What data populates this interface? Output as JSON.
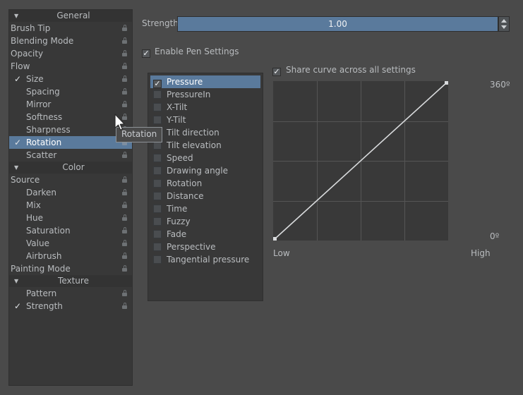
{
  "app": {
    "background_color": "#4a4a4a",
    "panel_color": "#383838",
    "accent_color": "#5a7a9c"
  },
  "sidebar": {
    "groups": [
      {
        "name": "General",
        "collapse_icon": "triangle-down-icon",
        "items": [
          {
            "label": "Brush Tip",
            "checkbox": false,
            "checked": false,
            "selected": false,
            "lock": true
          },
          {
            "label": "Blending Mode",
            "checkbox": false,
            "checked": false,
            "selected": false,
            "lock": true
          },
          {
            "label": "Opacity",
            "checkbox": false,
            "checked": false,
            "selected": false,
            "lock": true
          },
          {
            "label": "Flow",
            "checkbox": false,
            "checked": false,
            "selected": false,
            "lock": true
          },
          {
            "label": "Size",
            "checkbox": true,
            "checked": true,
            "selected": false,
            "lock": true
          },
          {
            "label": "Spacing",
            "checkbox": true,
            "checked": false,
            "selected": false,
            "lock": true
          },
          {
            "label": "Mirror",
            "checkbox": true,
            "checked": false,
            "selected": false,
            "lock": true
          },
          {
            "label": "Softness",
            "checkbox": true,
            "checked": false,
            "selected": false,
            "lock": true
          },
          {
            "label": "Sharpness",
            "checkbox": true,
            "checked": false,
            "selected": false,
            "lock": true
          },
          {
            "label": "Rotation",
            "checkbox": true,
            "checked": true,
            "selected": true,
            "lock": true
          },
          {
            "label": "Scatter",
            "checkbox": true,
            "checked": false,
            "selected": false,
            "lock": true
          }
        ]
      },
      {
        "name": "Color",
        "collapse_icon": "triangle-down-icon",
        "items": [
          {
            "label": "Source",
            "checkbox": false,
            "checked": false,
            "selected": false,
            "lock": true
          },
          {
            "label": "Darken",
            "checkbox": true,
            "checked": false,
            "selected": false,
            "lock": true
          },
          {
            "label": "Mix",
            "checkbox": true,
            "checked": false,
            "selected": false,
            "lock": true
          },
          {
            "label": "Hue",
            "checkbox": true,
            "checked": false,
            "selected": false,
            "lock": true
          },
          {
            "label": "Saturation",
            "checkbox": true,
            "checked": false,
            "selected": false,
            "lock": true
          },
          {
            "label": "Value",
            "checkbox": true,
            "checked": false,
            "selected": false,
            "lock": true
          },
          {
            "label": "Airbrush",
            "checkbox": true,
            "checked": false,
            "selected": false,
            "lock": true
          },
          {
            "label": "Painting Mode",
            "checkbox": false,
            "checked": false,
            "selected": false,
            "lock": true
          }
        ]
      },
      {
        "name": "Texture",
        "collapse_icon": "triangle-down-icon",
        "items": [
          {
            "label": "Pattern",
            "checkbox": true,
            "checked": false,
            "selected": false,
            "lock": true
          },
          {
            "label": "Strength",
            "checkbox": true,
            "checked": true,
            "selected": false,
            "lock": true
          }
        ]
      }
    ]
  },
  "strength": {
    "label": "Strength:",
    "value": "1.00",
    "spin_up_icon": "triangle-up-icon",
    "spin_down_icon": "triangle-down-icon"
  },
  "enable_pen_settings": {
    "label": "Enable Pen Settings",
    "checked": true,
    "check_glyph": "✓"
  },
  "share_curve": {
    "label": "Share curve across all settings",
    "checked": true,
    "check_glyph": "✓"
  },
  "sensors": {
    "items": [
      {
        "label": "Pressure",
        "checked": true,
        "selected": true
      },
      {
        "label": "PressureIn",
        "checked": false,
        "selected": false
      },
      {
        "label": "X-Tilt",
        "checked": false,
        "selected": false
      },
      {
        "label": "Y-Tilt",
        "checked": false,
        "selected": false
      },
      {
        "label": "Tilt direction",
        "checked": false,
        "selected": false
      },
      {
        "label": "Tilt elevation",
        "checked": false,
        "selected": false
      },
      {
        "label": "Speed",
        "checked": false,
        "selected": false
      },
      {
        "label": "Drawing angle",
        "checked": false,
        "selected": false
      },
      {
        "label": "Rotation",
        "checked": false,
        "selected": false
      },
      {
        "label": "Distance",
        "checked": false,
        "selected": false
      },
      {
        "label": "Time",
        "checked": false,
        "selected": false
      },
      {
        "label": "Fuzzy",
        "checked": false,
        "selected": false
      },
      {
        "label": "Fade",
        "checked": false,
        "selected": false
      },
      {
        "label": "Perspective",
        "checked": false,
        "selected": false
      },
      {
        "label": "Tangential pressure",
        "checked": false,
        "selected": false
      }
    ]
  },
  "curve": {
    "top_label": "360º",
    "bottom_label": "0º",
    "left_label": "Low",
    "right_label": "High",
    "grid_divisions": 4,
    "curve_color": "#d9dbdd",
    "points": [
      [
        0,
        0
      ],
      [
        1,
        1
      ]
    ]
  },
  "tooltip": {
    "text": "Rotation"
  },
  "cursor": {
    "icon": "arrow-pointer-icon"
  }
}
